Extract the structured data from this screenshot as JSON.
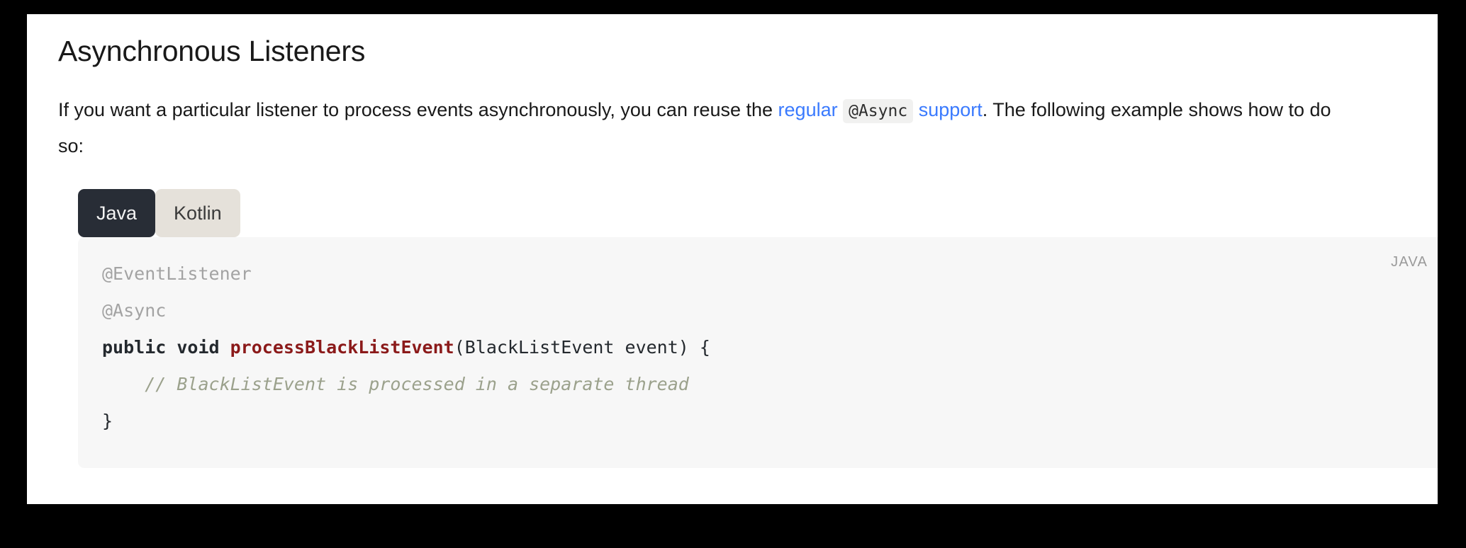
{
  "page": {
    "title": "Asynchronous Listeners",
    "paragraph": {
      "segment_1": "If you want a particular listener to process events asynchronously, you can reuse the ",
      "link_1": "regular",
      "inline_code": "@Async",
      "link_2": "support",
      "segment_2": ". The following example shows how to do so:"
    }
  },
  "tabs": {
    "items": [
      {
        "label": "Java",
        "active": true
      },
      {
        "label": "Kotlin",
        "active": false
      }
    ]
  },
  "code_block": {
    "language_label": "JAVA",
    "lines": [
      {
        "indent": "",
        "tokens": [
          {
            "text": "@EventListener",
            "type": "annotation"
          }
        ]
      },
      {
        "indent": "",
        "tokens": [
          {
            "text": "@Async",
            "type": "annotation"
          }
        ]
      },
      {
        "indent": "",
        "tokens": [
          {
            "text": "public void ",
            "type": "keyword"
          },
          {
            "text": "processBlackListEvent",
            "type": "function"
          },
          {
            "text": "(BlackListEvent event) {",
            "type": "plain"
          }
        ]
      },
      {
        "indent": "    ",
        "tokens": [
          {
            "text": "// BlackListEvent is processed in a separate thread",
            "type": "comment"
          }
        ]
      },
      {
        "indent": "",
        "tokens": [
          {
            "text": "}",
            "type": "plain"
          }
        ]
      }
    ]
  },
  "colors": {
    "link": "#3a7afe",
    "tab_active_bg": "#282d36",
    "tab_inactive_bg": "#e5e1da",
    "code_bg": "#f7f7f7",
    "code_function": "#8b1a1a",
    "code_comment": "#9ba18c",
    "code_annotation": "#a3a3a3",
    "page_bg": "#ffffff",
    "frame": "#000000"
  }
}
